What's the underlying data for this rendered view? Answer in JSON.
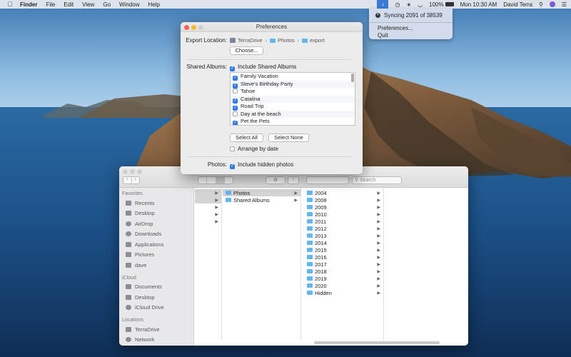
{
  "menubar": {
    "app": "Finder",
    "menus": [
      "File",
      "Edit",
      "View",
      "Go",
      "Window",
      "Help"
    ],
    "battery": "100%",
    "datetime": "Mon 10:30 AM",
    "user": "David Terra"
  },
  "dropdown": {
    "status": "Syncing 2091 of 38539",
    "items": [
      "Preferences...",
      "Quit"
    ]
  },
  "prefs": {
    "title": "Preferences",
    "export_label": "Export Location:",
    "path": [
      "TerraDrive",
      "Photos",
      "export"
    ],
    "choose_button": "Choose...",
    "shared_label": "Shared Albums:",
    "include_shared": "Include Shared Albums",
    "albums": [
      {
        "name": "Family Vacation",
        "checked": true
      },
      {
        "name": "Steve's Birthday Party",
        "checked": true
      },
      {
        "name": "Tahoe",
        "checked": false
      },
      {
        "name": "Catalina",
        "checked": true
      },
      {
        "name": "Road Trip",
        "checked": true
      },
      {
        "name": "Day at the beach",
        "checked": false
      },
      {
        "name": "Pet the Pets",
        "checked": true
      }
    ],
    "select_all": "Select All",
    "select_none": "Select None",
    "arrange": "Arrange by date",
    "photos_label": "Photos:",
    "include_hidden": "Include hidden photos"
  },
  "finder": {
    "search_placeholder": "Search",
    "sidebar": [
      {
        "section": "Favorites",
        "items": [
          "Recents",
          "Desktop",
          "AirDrop",
          "Downloads",
          "Applications",
          "Pictures",
          "dave"
        ]
      },
      {
        "section": "iCloud",
        "items": [
          "Documents",
          "Desktop",
          "iCloud Drive"
        ]
      },
      {
        "section": "Locations",
        "items": [
          "TerraDrive",
          "Network"
        ]
      }
    ],
    "col2": [
      "Photos",
      "Shared Albums"
    ],
    "col3": [
      "2004",
      "2008",
      "2009",
      "2010",
      "2011",
      "2012",
      "2013",
      "2014",
      "2015",
      "2016",
      "2017",
      "2018",
      "2019",
      "2020",
      "Hidden"
    ]
  },
  "colors": {
    "accent": "#2f7ae5",
    "folder": "#63b6f0"
  }
}
